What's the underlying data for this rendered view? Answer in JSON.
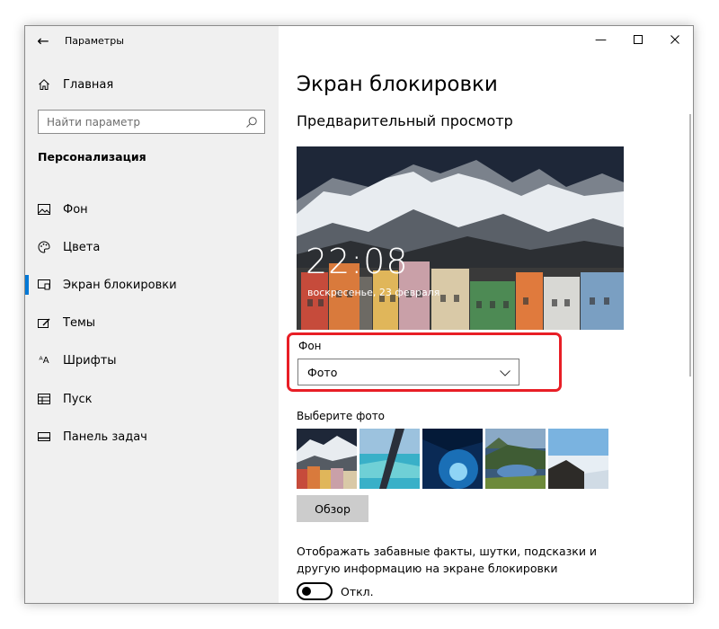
{
  "window": {
    "app_title": "Параметры"
  },
  "sidebar": {
    "home_label": "Главная",
    "search_placeholder": "Найти параметр",
    "section": "Персонализация",
    "items": [
      {
        "label": "Фон",
        "icon": "picture-icon"
      },
      {
        "label": "Цвета",
        "icon": "palette-icon"
      },
      {
        "label": "Экран блокировки",
        "icon": "lock-screen-icon",
        "active": true
      },
      {
        "label": "Темы",
        "icon": "themes-icon"
      },
      {
        "label": "Шрифты",
        "icon": "fonts-icon"
      },
      {
        "label": "Пуск",
        "icon": "start-icon"
      },
      {
        "label": "Панель задач",
        "icon": "taskbar-icon"
      }
    ]
  },
  "main": {
    "title": "Экран блокировки",
    "preview_title": "Предварительный просмотр",
    "preview": {
      "time": "22:08",
      "date": "воскресенье, 23 февраля"
    },
    "background_label": "Фон",
    "background_value": "Фото",
    "choose_photo_label": "Выберите фото",
    "browse_label": "Обзор",
    "facts_text": "Отображать забавные факты, шутки, подсказки и другую информацию на экране блокировки",
    "toggle_state": "Откл."
  },
  "colors": {
    "accent": "#0078d7",
    "highlight": "#e81e26"
  }
}
